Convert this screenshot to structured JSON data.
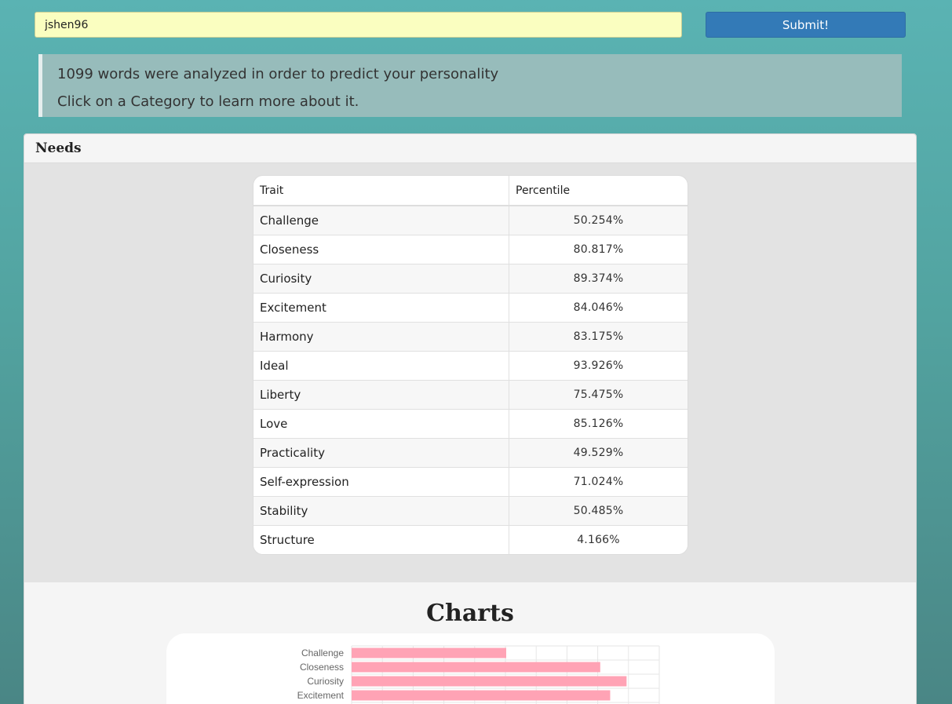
{
  "search": {
    "value": "jshen96"
  },
  "submit_label": "Submit!",
  "info": {
    "line1": "1099 words were analyzed in order to predict your personality",
    "line2": "Click on a Category to learn more about it."
  },
  "panel": {
    "title": "Needs"
  },
  "table": {
    "headers": {
      "trait": "Trait",
      "percentile": "Percentile"
    },
    "rows": [
      {
        "trait": "Challenge",
        "percentile": "50.254%"
      },
      {
        "trait": "Closeness",
        "percentile": "80.817%"
      },
      {
        "trait": "Curiosity",
        "percentile": "89.374%"
      },
      {
        "trait": "Excitement",
        "percentile": "84.046%"
      },
      {
        "trait": "Harmony",
        "percentile": "83.175%"
      },
      {
        "trait": "Ideal",
        "percentile": "93.926%"
      },
      {
        "trait": "Liberty",
        "percentile": "75.475%"
      },
      {
        "trait": "Love",
        "percentile": "85.126%"
      },
      {
        "trait": "Practicality",
        "percentile": "49.529%"
      },
      {
        "trait": "Self-expression",
        "percentile": "71.024%"
      },
      {
        "trait": "Stability",
        "percentile": "50.485%"
      },
      {
        "trait": "Structure",
        "percentile": "4.166%"
      }
    ]
  },
  "charts": {
    "title": "Charts"
  },
  "chart_data": {
    "type": "bar",
    "orientation": "horizontal",
    "categories": [
      "Challenge",
      "Closeness",
      "Curiosity",
      "Excitement"
    ],
    "values": [
      50.254,
      80.817,
      89.374,
      84.046
    ],
    "xlim": [
      0,
      100
    ],
    "grid": true,
    "bar_color": "#ffa3b5",
    "grid_color": "#e6e6e6"
  },
  "colors": {
    "submit": "#337ab7",
    "input_bg": "#fafec0"
  }
}
